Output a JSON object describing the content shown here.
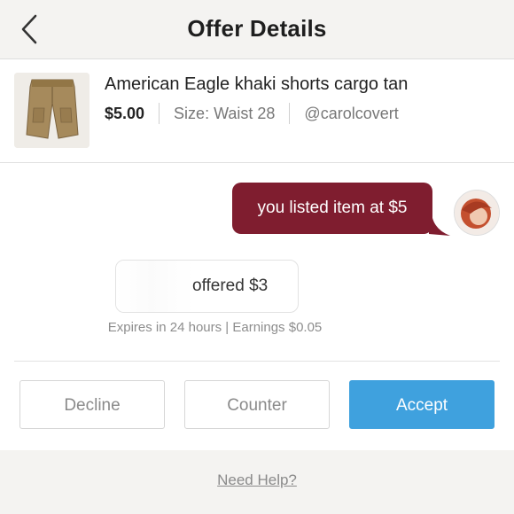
{
  "header": {
    "title": "Offer Details",
    "back_icon": "chevron-left-icon"
  },
  "item": {
    "title": "American Eagle khaki shorts cargo tan",
    "price": "$5.00",
    "size": "Size: Waist 28",
    "seller": "@carolcovert"
  },
  "messages": {
    "seller_text": "you listed item at $5",
    "buyer_text": "offered $3",
    "seller_bubble_color": "#7f1d2f"
  },
  "offer": {
    "expires": "Expires in 24 hours | Earnings $0.05"
  },
  "actions": {
    "decline": "Decline",
    "counter": "Counter",
    "accept": "Accept",
    "accept_color": "#3fa1de"
  },
  "footer": {
    "help": "Need Help?"
  }
}
